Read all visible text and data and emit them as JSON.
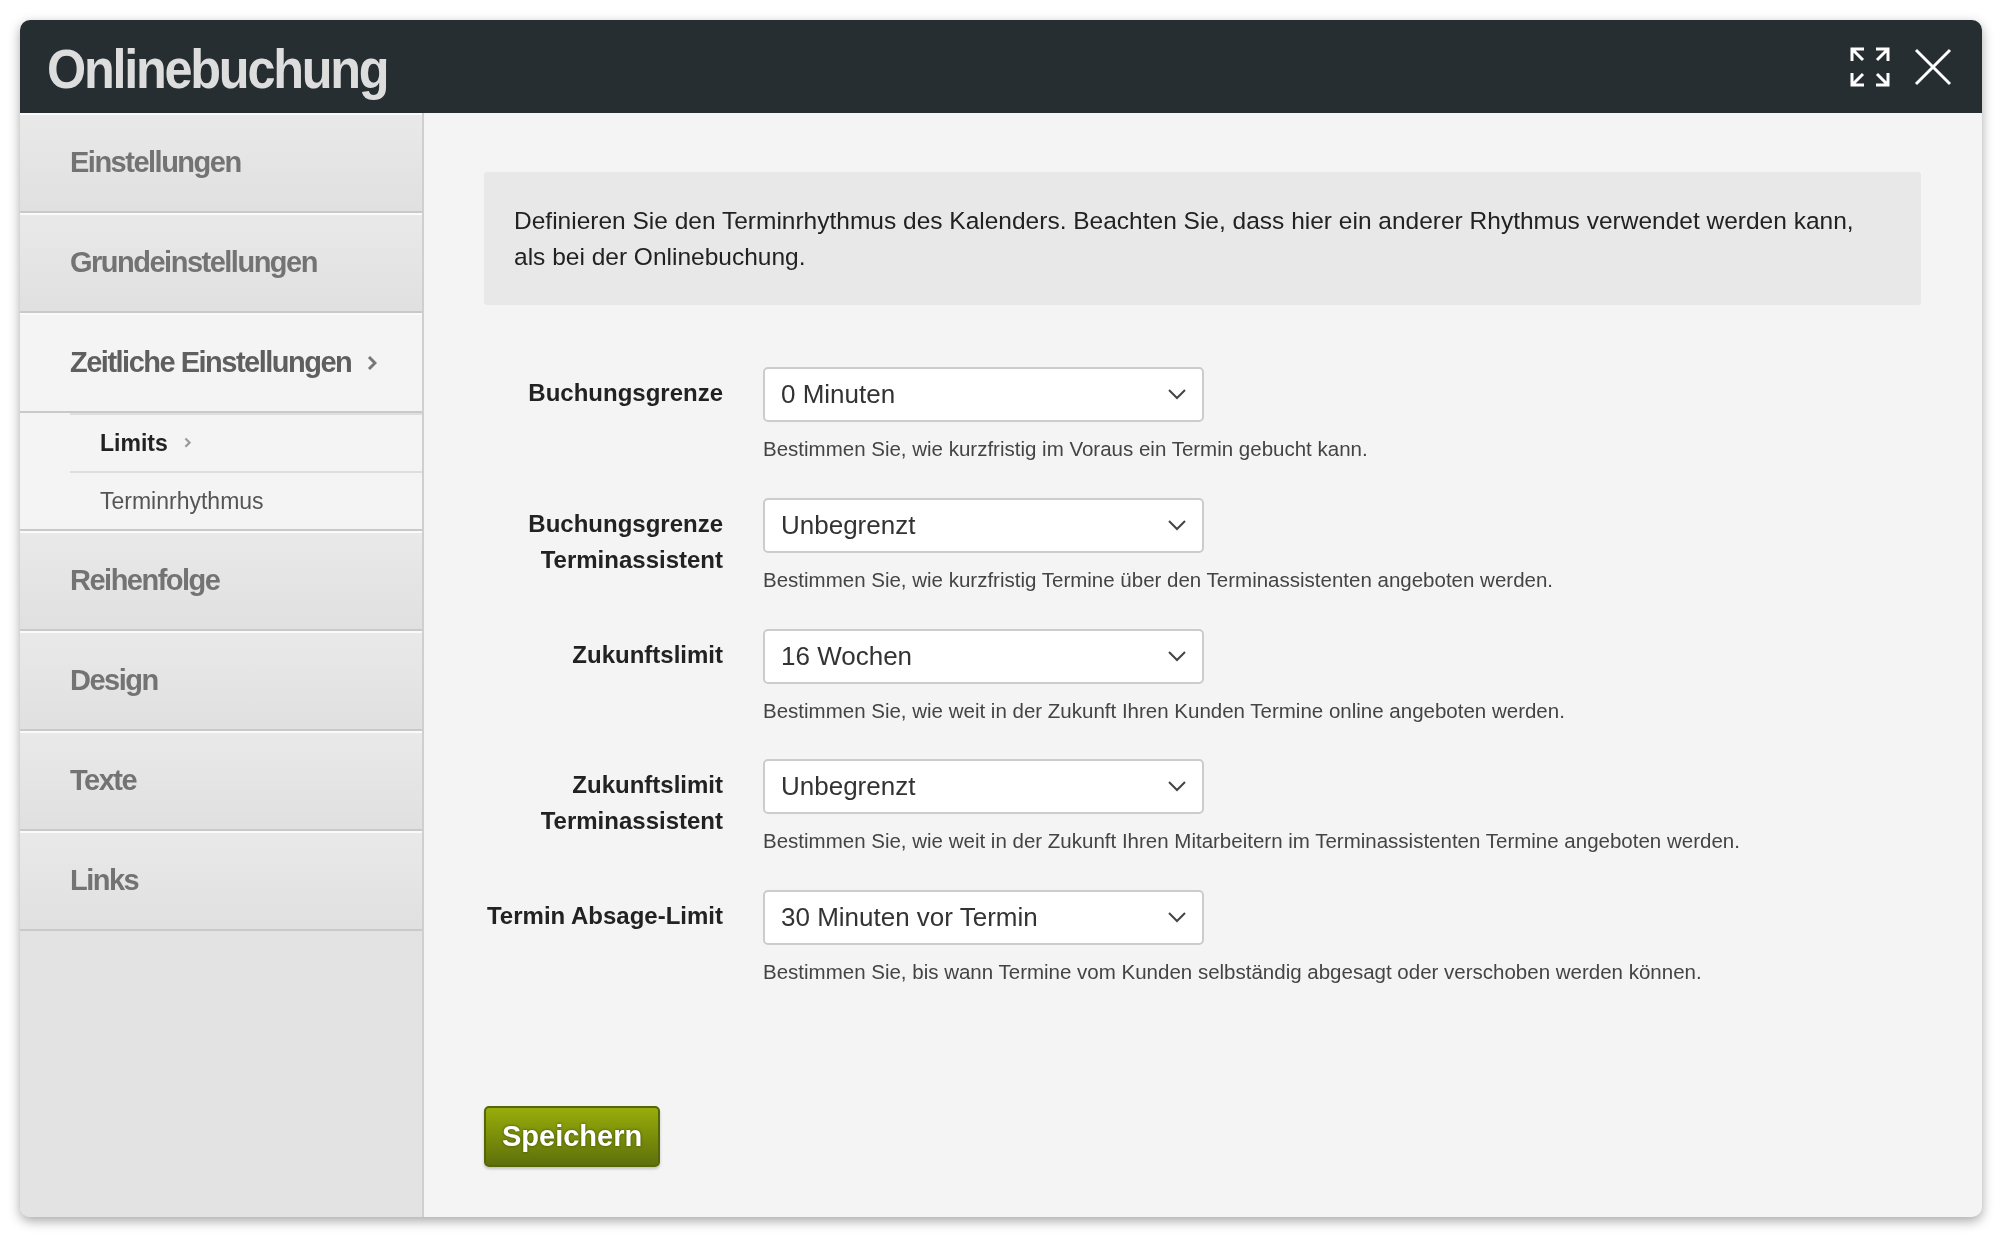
{
  "window": {
    "title": "Onlinebuchung"
  },
  "sidebar": {
    "items": [
      {
        "label": "Einstellungen",
        "selected": false
      },
      {
        "label": "Grundeinstellungen",
        "selected": false
      },
      {
        "label": "Zeitliche Einstellungen",
        "selected": true,
        "expanded": true,
        "children": [
          {
            "label": "Limits",
            "selected": true
          },
          {
            "label": "Terminrhythmus",
            "selected": false
          }
        ]
      },
      {
        "label": "Reihenfolge",
        "selected": false
      },
      {
        "label": "Design",
        "selected": false
      },
      {
        "label": "Texte",
        "selected": false
      },
      {
        "label": "Links",
        "selected": false
      }
    ]
  },
  "info": "Definieren Sie den Terminrhythmus des Kalenders. Beachten Sie, dass hier ein anderer Rhythmus verwendet werden kann, als bei der Onlinebuchung.",
  "form": [
    {
      "label": [
        "Buchungsgrenze"
      ],
      "value": "0 Minuten",
      "help": "Bestimmen Sie, wie kurzfristig im Voraus ein Termin gebucht kann."
    },
    {
      "label": [
        "Buchungsgrenze",
        "Terminassistent"
      ],
      "value": "Unbegrenzt",
      "help": "Bestimmen Sie, wie kurzfristig Termine über den Terminassistenten angeboten werden."
    },
    {
      "label": [
        "Zukunftslimit"
      ],
      "value": "16 Wochen",
      "help": "Bestimmen Sie, wie weit in der Zukunft Ihren Kunden Termine online angeboten werden."
    },
    {
      "label": [
        "Zukunftslimit",
        "Terminassistent"
      ],
      "value": "Unbegrenzt",
      "help": "Bestimmen Sie, wie weit in der Zukunft Ihren Mitarbeitern im Terminassistenten Termine angeboten werden."
    },
    {
      "label": [
        "Termin Absage-Limit"
      ],
      "value": "30 Minuten vor Termin",
      "help": "Bestimmen Sie, bis wann Termine vom Kunden selbständig abgesagt oder verschoben werden können."
    }
  ],
  "buttons": [
    "Speichern"
  ]
}
